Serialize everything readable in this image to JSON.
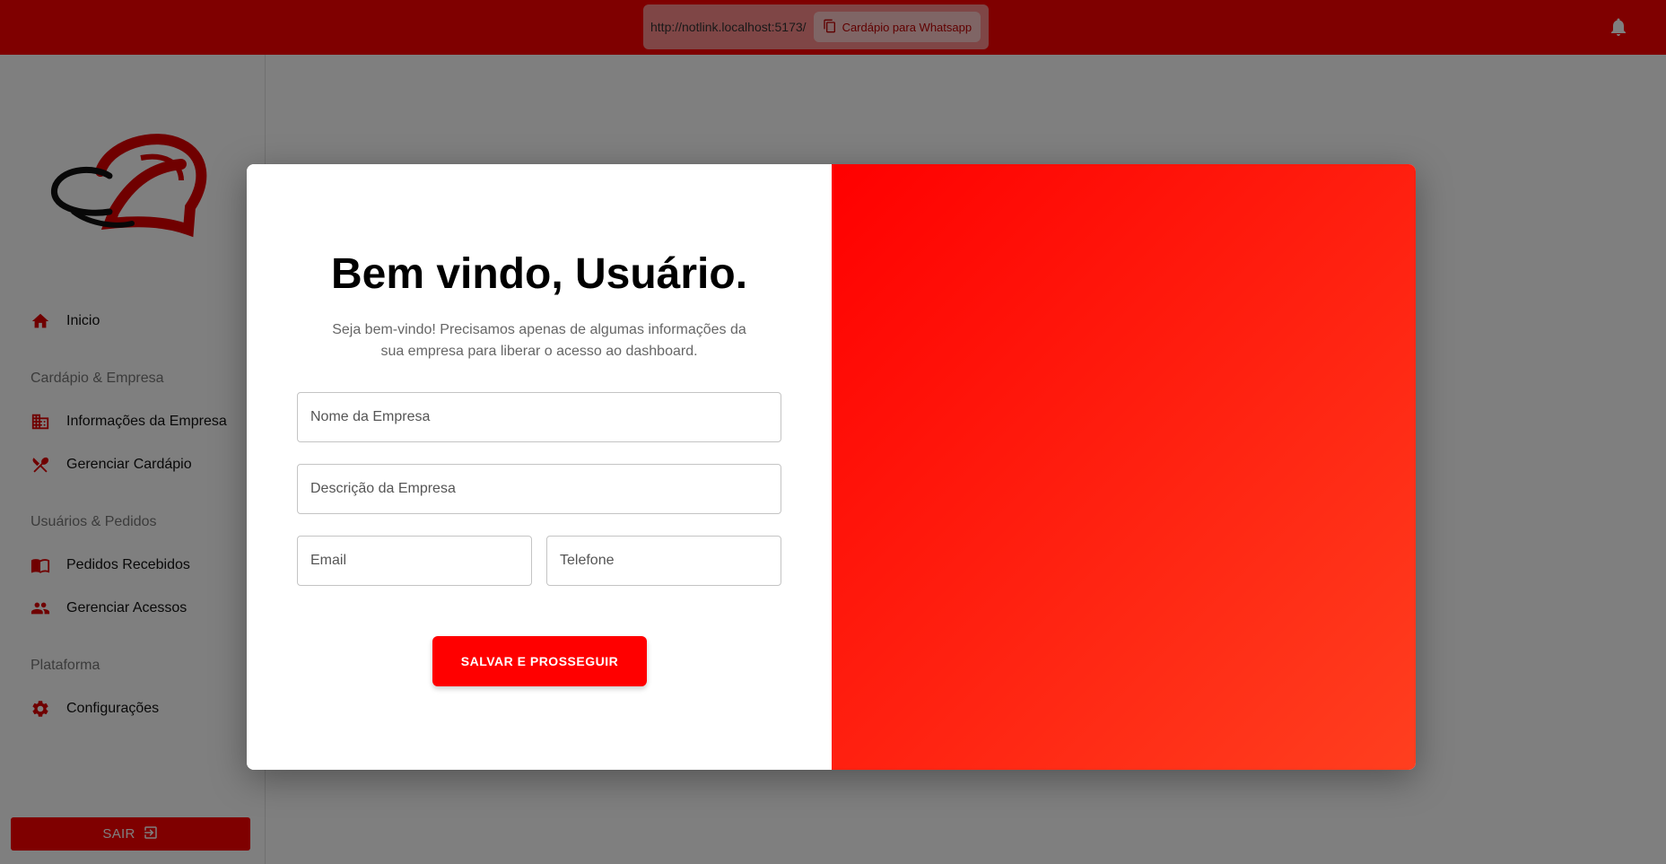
{
  "topbar": {
    "url": "http://notlink.localhost:5173/",
    "copy_label": "Cardápio para Whatsapp",
    "bell_icon": "bell-icon"
  },
  "sidebar": {
    "items": [
      {
        "label": "Inicio",
        "icon": "home-icon"
      },
      {
        "section": "Cardápio & Empresa"
      },
      {
        "label": "Informações da Empresa",
        "icon": "building-icon"
      },
      {
        "label": "Gerenciar Cardápio",
        "icon": "cutlery-icon"
      },
      {
        "section": "Usuários & Pedidos"
      },
      {
        "label": "Pedidos Recebidos",
        "icon": "book-icon"
      },
      {
        "label": "Gerenciar Acessos",
        "icon": "people-icon"
      },
      {
        "section": "Plataforma"
      },
      {
        "label": "Configurações",
        "icon": "gear-icon"
      }
    ],
    "logout_label": "SAIR"
  },
  "modal": {
    "title": "Bem vindo, Usuário.",
    "subtitle": "Seja bem-vindo! Precisamos apenas de algumas informações da sua empresa para liberar o acesso ao dashboard.",
    "fields": {
      "company_name": {
        "placeholder": "Nome da Empresa",
        "value": ""
      },
      "company_description": {
        "placeholder": "Descrição da Empresa",
        "value": ""
      },
      "email": {
        "placeholder": "Email",
        "value": ""
      },
      "phone": {
        "placeholder": "Telefone",
        "value": ""
      }
    },
    "submit_label": "SALVAR E PROSSEGUIR"
  },
  "colors": {
    "brand": "#ff0000",
    "gradient_end": "#ff3f1f"
  }
}
